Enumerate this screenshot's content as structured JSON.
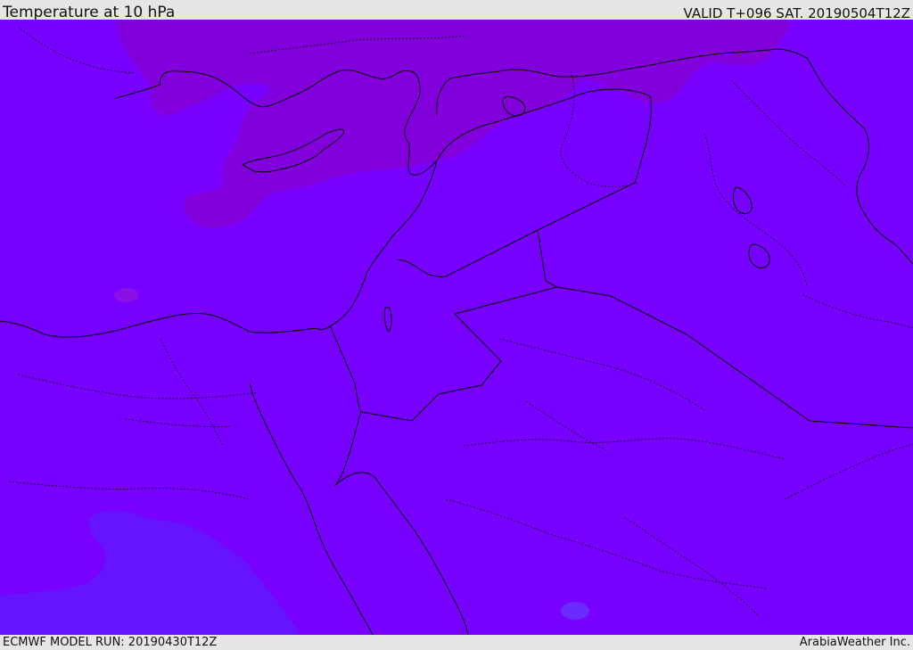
{
  "header": {
    "title": "Temperature at 10 hPa",
    "valid_time": "VALID T+096 SAT. 20190504T12Z"
  },
  "footer": {
    "model_run": "ECMWF MODEL RUN: 20190430T12Z",
    "credit": "ArabiaWeather Inc."
  },
  "map": {
    "colors": {
      "background": "#7800ff",
      "cold_region": "#8200dc",
      "warm_region": "#6614ff",
      "cold_spot": "#8a10e6",
      "warm_spot": "#6a2bff",
      "boundary": "#000000",
      "frame": "#e6e6e6"
    }
  }
}
